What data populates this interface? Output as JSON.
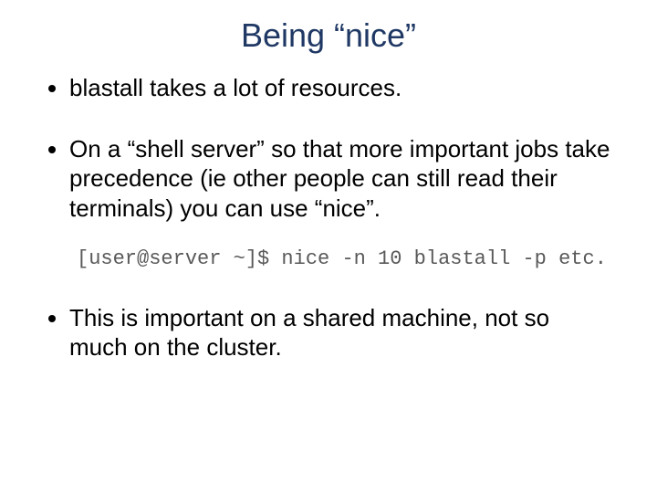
{
  "title": "Being “nice”",
  "bullets": {
    "b1": "blastall takes a lot of resources.",
    "b2": "On a “shell server” so that more important jobs take precedence (ie other people can still read their terminals) you can use “nice”.",
    "b3": "This is important on a shared machine, not so much on the cluster."
  },
  "code": "[user@server ~]$ nice -n 10 blastall -p etc."
}
